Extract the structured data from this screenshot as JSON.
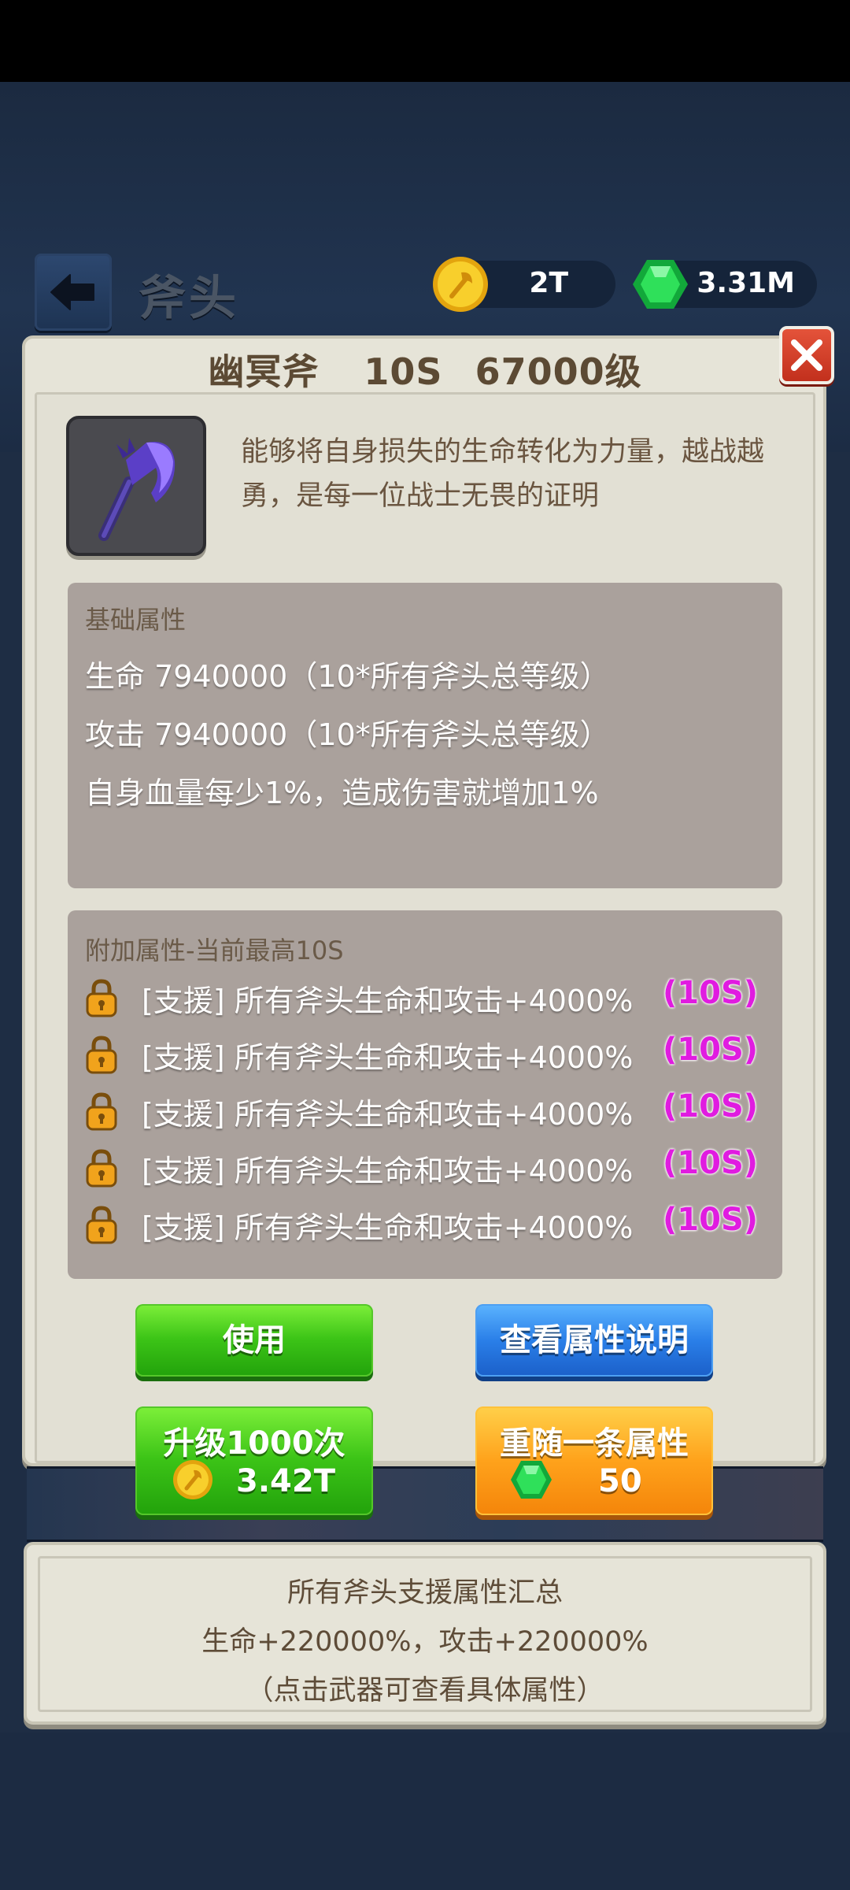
{
  "header": {
    "title": "斧头",
    "gold": "2T",
    "gems": "3.31M",
    "colors": {
      "gold": "#f5c518",
      "gem": "#1fd24a"
    }
  },
  "item": {
    "name": "幽冥斧",
    "tier": "10S",
    "level": "67000级",
    "icon": "purple-axe-icon",
    "description": "能够将自身损失的生命转化为力量，越战越勇，是每一位战士无畏的证明"
  },
  "base_attributes": {
    "title": "基础属性",
    "lines": [
      "生命 7940000（10*所有斧头总等级）",
      "攻击 7940000（10*所有斧头总等级）",
      "自身血量每少1%，造成伤害就增加1%"
    ]
  },
  "extra_attributes": {
    "title": "附加属性-当前最高10S",
    "rows": [
      {
        "text": "[支援] 所有斧头生命和攻击+4000%",
        "tier": "(10S)"
      },
      {
        "text": "[支援] 所有斧头生命和攻击+4000%",
        "tier": "(10S)"
      },
      {
        "text": "[支援] 所有斧头生命和攻击+4000%",
        "tier": "(10S)"
      },
      {
        "text": "[支援] 所有斧头生命和攻击+4000%",
        "tier": "(10S)"
      },
      {
        "text": "[支援] 所有斧头生命和攻击+4000%",
        "tier": "(10S)"
      }
    ],
    "tier_color": "#e01ce0"
  },
  "buttons": {
    "use": "使用",
    "view_info": "查看属性说明",
    "upgrade": "升级1000次",
    "upgrade_cost": "3.42T",
    "reroll": "重随一条属性",
    "reroll_cost": "50"
  },
  "summary": {
    "title": "所有斧头支援属性汇总",
    "stats": "生命+220000%，攻击+220000%",
    "hint": "（点击武器可查看具体属性）"
  }
}
